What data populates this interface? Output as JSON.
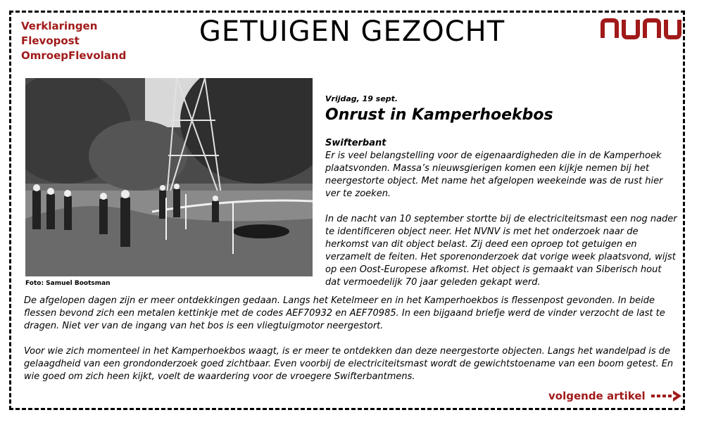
{
  "sources": [
    "Verklaringen",
    "Flevopost",
    "OmroepFlevoland"
  ],
  "header": {
    "title": "GETUIGEN GEZOCHT",
    "logo_text": "nunu"
  },
  "photo": {
    "credit": "Foto: Samuel Bootsman"
  },
  "article": {
    "date": "Vrijdag, 19 sept.",
    "headline": "Onrust in Kamperhoekbos",
    "dateline": "Swifterbant",
    "paragraphs": [
      "Er is veel belangstelling voor de eigenaardigheden die in de Kamperhoek plaatsvonden. Massa’s nieuwsgierigen komen een kijkje nemen bij het neergestorte object. Met name het afgelopen weekeinde was de rust hier ver te zoeken.",
      "In de nacht van 10 september stortte bij de electriciteitsmast een nog nader te identificeren object neer. Het NVNV is met het onderzoek naar de herkomst van dit object belast. Zij deed een oproep tot getuigen en verzamelt de feiten. Het sporenonderzoek dat vorige week plaatsvond, wijst op een Oost-Europese afkomst. Het object is gemaakt van Siberisch hout dat vermoedelijk 70 jaar geleden gekapt werd.",
      "De afgelopen dagen zijn er meer ontdekkingen gedaan. Langs het Ketelmeer en in het Kamperhoekbos is flessenpost gevonden. In beide flessen bevond zich een metalen kettinkje met de codes AEF70932 en AEF70985. In een bijgaand briefje werd de vinder verzocht de last te dragen. Niet ver van de ingang van het bos is een vliegtuigmotor neergestort.",
      "Voor wie zich momenteel in het Kamperhoekbos waagt, is er meer te ontdekken dan deze neergestorte objecten. Langs het wandelpad is de gelaagdheid van een grondonderzoek goed zichtbaar. Even voorbij de electriciteitsmast wordt de gewichtstoename van een boom getest. En wie goed om zich heen kijkt, voelt de waardering voor de vroegere Swifterbantmens."
    ]
  },
  "nav": {
    "next_label": "volgende artikel"
  },
  "colors": {
    "accent": "#a11a1a",
    "text": "#000000",
    "background": "#ffffff"
  }
}
